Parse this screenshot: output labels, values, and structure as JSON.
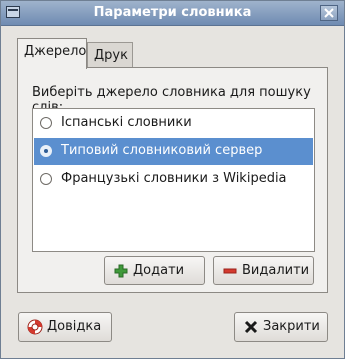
{
  "window": {
    "title": "Параметри словника"
  },
  "tabs": [
    {
      "label": "Джерело",
      "active": true
    },
    {
      "label": "Друк",
      "active": false
    }
  ],
  "source": {
    "prompt": "Виберіть джерело словника для пошуку слів:",
    "items": [
      {
        "label": "Іспанські словники",
        "selected": false
      },
      {
        "label": "Типовий словниковий сервер",
        "selected": true
      },
      {
        "label": "Французькі словники з Wikipedia",
        "selected": false
      }
    ],
    "add_label": "Додати",
    "remove_label": "Видалити"
  },
  "footer": {
    "help_label": "Довідка",
    "close_label": "Закрити"
  },
  "colors": {
    "titlebar": "#7d96b8",
    "selection": "#5b8fcf",
    "add_icon": "#3f9a3a",
    "remove_icon": "#d43a2f"
  }
}
